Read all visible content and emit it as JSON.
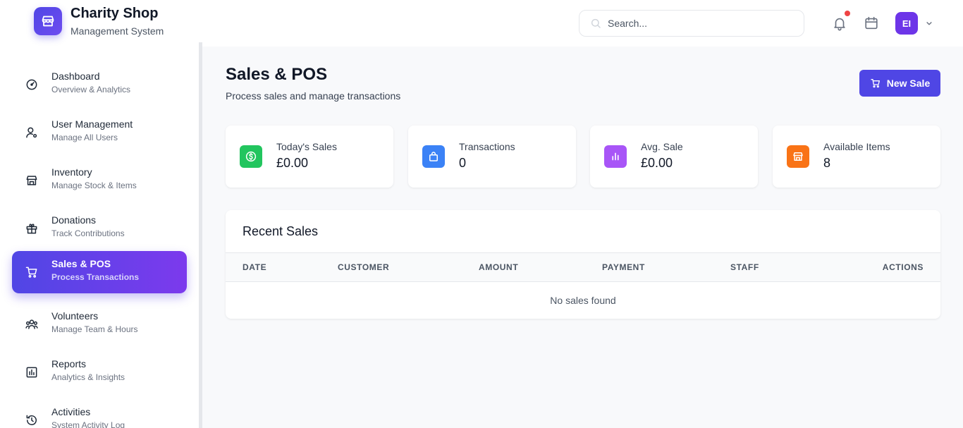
{
  "brand": {
    "title": "Charity Shop",
    "subtitle": "Management System"
  },
  "search": {
    "placeholder": "Search..."
  },
  "user": {
    "initials": "EI"
  },
  "sidebar": {
    "items": [
      {
        "label": "Dashboard",
        "sub": "Overview & Analytics",
        "icon": "gauge-icon"
      },
      {
        "label": "User Management",
        "sub": "Manage All Users",
        "icon": "user-gear-icon"
      },
      {
        "label": "Inventory",
        "sub": "Manage Stock & Items",
        "icon": "store-icon"
      },
      {
        "label": "Donations",
        "sub": "Track Contributions",
        "icon": "gift-icon"
      },
      {
        "label": "Sales & POS",
        "sub": "Process Transactions",
        "icon": "cart-icon",
        "active": true
      },
      {
        "label": "Volunteers",
        "sub": "Manage Team & Hours",
        "icon": "users-icon"
      },
      {
        "label": "Reports",
        "sub": "Analytics & Insights",
        "icon": "chart-icon"
      },
      {
        "label": "Activities",
        "sub": "System Activity Log",
        "icon": "history-icon"
      }
    ]
  },
  "page": {
    "title": "Sales & POS",
    "subtitle": "Process sales and manage transactions",
    "new_sale_label": "New Sale"
  },
  "stats": [
    {
      "label": "Today's Sales",
      "value": "£0.00",
      "color": "#22c55e",
      "icon": "dollar-circle-icon"
    },
    {
      "label": "Transactions",
      "value": "0",
      "color": "#3b82f6",
      "icon": "bag-icon"
    },
    {
      "label": "Avg. Sale",
      "value": "£0.00",
      "color": "#a855f7",
      "icon": "bar-chart-icon"
    },
    {
      "label": "Available Items",
      "value": "8",
      "color": "#f97316",
      "icon": "store-icon"
    }
  ],
  "recent_sales": {
    "title": "Recent Sales",
    "columns": [
      "DATE",
      "CUSTOMER",
      "AMOUNT",
      "PAYMENT",
      "STAFF",
      "ACTIONS"
    ],
    "empty_text": "No sales found"
  },
  "colors": {
    "accent": "#4f46e5",
    "accent2": "#7c3aed",
    "notification": "#ef4444"
  }
}
